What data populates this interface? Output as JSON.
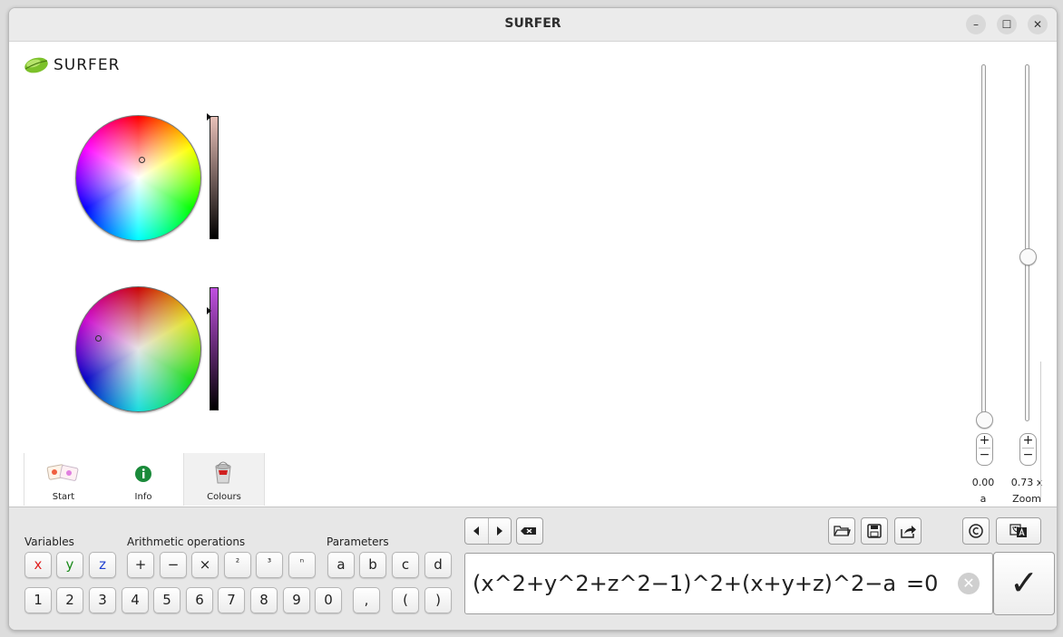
{
  "window": {
    "title": "SURFER"
  },
  "logo": {
    "text": "SURFER"
  },
  "tabs": [
    {
      "label": "Start",
      "icon": "start-icon"
    },
    {
      "label": "Info",
      "icon": "info-icon"
    },
    {
      "label": "Colours",
      "icon": "paint-bucket-icon",
      "active": true
    }
  ],
  "sliders": {
    "a": {
      "value": "0.00",
      "label": "a",
      "level": 0.0
    },
    "zoom": {
      "value": "0.73 x",
      "label": "Zoom",
      "level": 0.54
    }
  },
  "stepper": {
    "plus": "+",
    "minus": "−"
  },
  "keyboard": {
    "variables_label": "Variables",
    "arithmetic_label": "Arithmetic operations",
    "parameters_label": "Parameters",
    "variables": [
      "x",
      "y",
      "z"
    ],
    "variable_colors": [
      "#e02020",
      "#1a8a1a",
      "#2040d0"
    ],
    "operations": [
      "+",
      "−",
      "×",
      "²",
      "³",
      "ⁿ"
    ],
    "parameters": [
      "a",
      "b",
      "c",
      "d"
    ],
    "digits": [
      "1",
      "2",
      "3",
      "4",
      "5",
      "6",
      "7",
      "8",
      "9",
      "0"
    ],
    "comma": ",",
    "lparen": "(",
    "rparen": ")"
  },
  "formula": {
    "text": "(x^2+y^2+z^2−1)^2+(x+y+z)^2−a",
    "equals": "=0"
  },
  "colors": {
    "outside_brightness_bar": "#e0b8b0",
    "inside_brightness_bar": "#c050e0"
  }
}
